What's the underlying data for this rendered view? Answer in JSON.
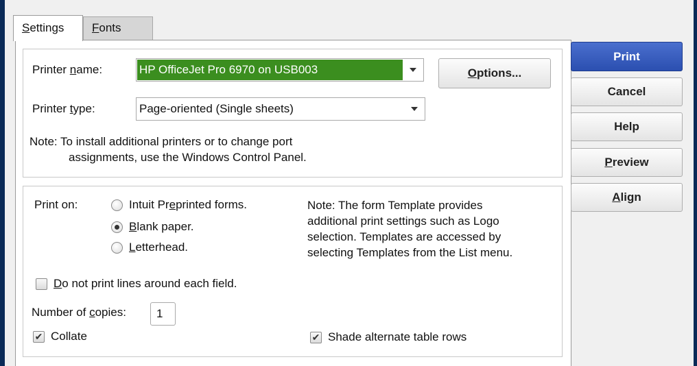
{
  "tabs": {
    "settings": {
      "pre": "",
      "ul": "S",
      "post": "ettings"
    },
    "fonts": {
      "pre": "",
      "ul": "F",
      "post": "onts"
    }
  },
  "printer": {
    "name_label": {
      "pre": "Printer ",
      "ul": "n",
      "post": "ame:"
    },
    "name_value": "HP OfficeJet Pro 6970 on USB003",
    "type_label": {
      "pre": "Printer ",
      "ul": "t",
      "post": "ype:"
    },
    "type_value": "Page-oriented (Single sheets)",
    "options_button": {
      "pre": "",
      "ul": "O",
      "post": "ptions..."
    },
    "note_line1": "Note: To install additional printers or to change port",
    "note_line2": "assignments, use the Windows Control Panel."
  },
  "print_on": {
    "label": "Print on:",
    "options": [
      {
        "pre": "Intuit Pr",
        "ul": "e",
        "post": "printed forms.",
        "checked": false
      },
      {
        "pre": "",
        "ul": "B",
        "post": "lank paper.",
        "checked": true
      },
      {
        "pre": "",
        "ul": "L",
        "post": "etterhead.",
        "checked": false
      }
    ],
    "note_lines": [
      "Note: The form Template provides",
      "additional print settings such as Logo",
      "selection.  Templates are accessed by",
      "selecting Templates from the List menu."
    ]
  },
  "no_lines": {
    "pre": "",
    "ul": "D",
    "post": "o not print lines around each field.",
    "checked": false
  },
  "copies": {
    "label": {
      "pre": "Number of ",
      "ul": "c",
      "post": "opies:"
    },
    "value": "1"
  },
  "collate": {
    "label": "Collate",
    "checked": true
  },
  "shade_rows": {
    "label": "Shade alternate table rows",
    "checked": true
  },
  "buttons": {
    "print": "Print",
    "cancel": "Cancel",
    "help": "Help",
    "preview": {
      "pre": "",
      "ul": "P",
      "post": "review"
    },
    "align": {
      "pre": "",
      "ul": "A",
      "post": "lign"
    }
  },
  "colors": {
    "selected_highlight": "#3b8e1f",
    "primary_button": "#2b4fb0",
    "window_frame": "#0a2a57"
  }
}
